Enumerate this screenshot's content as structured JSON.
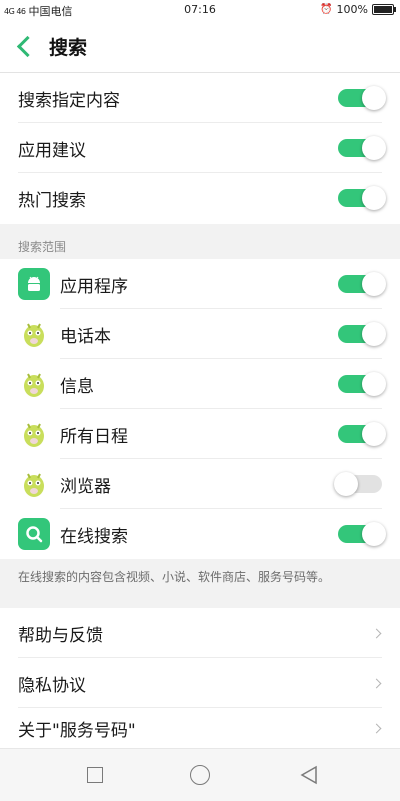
{
  "status_bar": {
    "signal": "4G 46",
    "carrier": "中国电信",
    "time": "07:16",
    "battery": "100%",
    "battery_level": 1.0
  },
  "header": {
    "title": "搜索"
  },
  "general": [
    {
      "label": "搜索指定内容",
      "on": true
    },
    {
      "label": "应用建议",
      "on": true
    },
    {
      "label": "热门搜索",
      "on": true
    }
  ],
  "scope": {
    "header": "搜索范围",
    "items": [
      {
        "label": "应用程序",
        "icon": "android-icon",
        "on": true
      },
      {
        "label": "电话本",
        "icon": "mascot-icon",
        "on": true
      },
      {
        "label": "信息",
        "icon": "mascot-icon",
        "on": true
      },
      {
        "label": "所有日程",
        "icon": "mascot-icon",
        "on": true
      },
      {
        "label": "浏览器",
        "icon": "mascot-icon",
        "on": false
      },
      {
        "label": "在线搜索",
        "icon": "search-icon",
        "on": true
      }
    ],
    "footnote": "在线搜索的内容包含视频、小说、软件商店、服务号码等。"
  },
  "links": [
    {
      "label": "帮助与反馈"
    },
    {
      "label": "隐私协议"
    },
    {
      "label": "关于\"服务号码\""
    }
  ],
  "colors": {
    "accent": "#33c67a",
    "back_arrow": "#2fb974",
    "section_bg": "#f2f2f2"
  }
}
